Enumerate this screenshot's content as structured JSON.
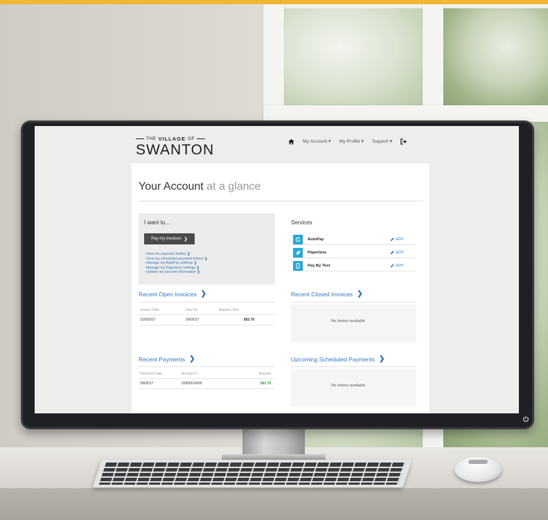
{
  "site": {
    "logo": {
      "prefix": "THE",
      "name_top": "VILLAGE",
      "connector": "OF",
      "name_main": "SWANTON"
    },
    "nav": {
      "items": [
        "My Account",
        "My Profile",
        "Support"
      ],
      "home_icon": "home-icon",
      "logout_icon": "sign-out-icon"
    }
  },
  "page": {
    "title_main": "Your Account",
    "title_muted": "at a glance"
  },
  "i_want": {
    "title": "I want to...",
    "pay_button": "Pay my invoices",
    "links": [
      "- View my payment history",
      "- View my scheduled payment history",
      "- Manage my AutoPay settings",
      "- Manage my Paperless settings",
      "- Update my account information"
    ]
  },
  "services": {
    "title": "Services",
    "items": [
      {
        "label": "AutoPay",
        "icon": "refresh-icon",
        "action": "EDIT"
      },
      {
        "label": "Paperless",
        "icon": "leaf-icon",
        "action": "EDIT"
      },
      {
        "label": "Pay By Text",
        "icon": "phone-icon",
        "action": "EDIT"
      }
    ]
  },
  "open_invoices": {
    "title": "Recent Open Invoices",
    "columns": [
      "Invoice Date",
      "Due On",
      "Balance Due"
    ],
    "rows": [
      {
        "invoice_date": "1/20/2017",
        "due_on": "2/9/2017",
        "balance_due": "$92.78"
      }
    ]
  },
  "closed_invoices": {
    "title": "Recent Closed Invoices",
    "empty": "No history available"
  },
  "payments": {
    "title": "Recent Payments",
    "columns": [
      "Payment Date",
      "Account #",
      "Amount"
    ],
    "rows": [
      {
        "payment_date": "2/8/2017",
        "account": "029000-0000",
        "amount": "$92.78"
      }
    ]
  },
  "scheduled_payments": {
    "title": "Upcoming Scheduled Payments",
    "empty": "No history available"
  },
  "colors": {
    "accent_blue": "#2f78c2",
    "service_teal": "#27a9d6",
    "amount_green": "#3a9a3a",
    "top_strip": "#f2b632"
  }
}
